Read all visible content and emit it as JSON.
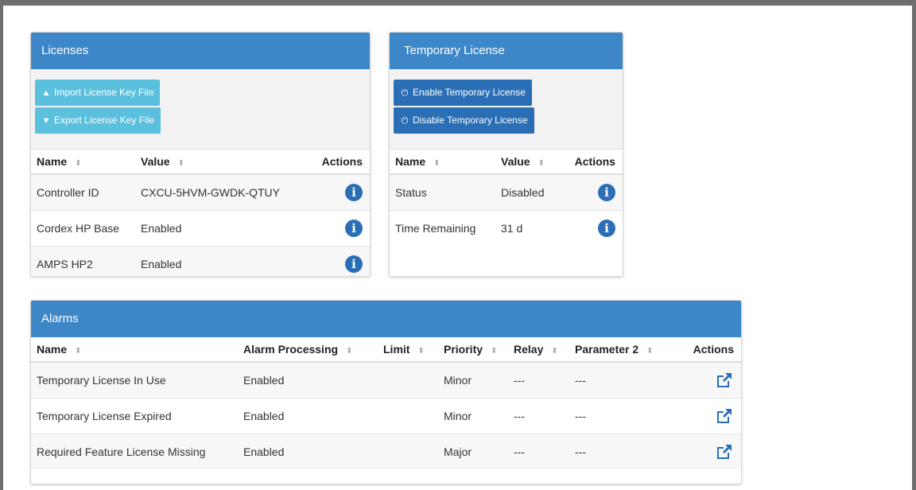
{
  "licenses": {
    "title": "Licenses",
    "import_label": "Import License Key File",
    "export_label": "Export License Key File",
    "columns": {
      "name": "Name",
      "value": "Value",
      "actions": "Actions"
    },
    "rows": [
      {
        "name": "Controller ID",
        "value": "CXCU-5HVM-GWDK-QTUY"
      },
      {
        "name": "Cordex HP Base",
        "value": "Enabled"
      },
      {
        "name": "AMPS HP2",
        "value": "Enabled"
      }
    ]
  },
  "temporary": {
    "title": "Temporary License",
    "enable_label": "Enable Temporary License",
    "disable_label": "Disable Temporary License",
    "columns": {
      "name": "Name",
      "value": "Value",
      "actions": "Actions"
    },
    "rows": [
      {
        "name": "Status",
        "value": "Disabled"
      },
      {
        "name": "Time Remaining",
        "value": "31 d"
      }
    ]
  },
  "alarms": {
    "title": "Alarms",
    "columns": {
      "name": "Name",
      "processing": "Alarm Processing",
      "limit": "Limit",
      "priority": "Priority",
      "relay": "Relay",
      "param2": "Parameter 2",
      "actions": "Actions"
    },
    "rows": [
      {
        "name": "Temporary License In Use",
        "processing": "Enabled",
        "limit": "",
        "priority": "Minor",
        "relay": "---",
        "param2": "---"
      },
      {
        "name": "Temporary License Expired",
        "processing": "Enabled",
        "limit": "",
        "priority": "Minor",
        "relay": "---",
        "param2": "---"
      },
      {
        "name": "Required Feature License Missing",
        "processing": "Enabled",
        "limit": "",
        "priority": "Major",
        "relay": "---",
        "param2": "---"
      }
    ]
  },
  "icons": {
    "info": "info-circle-icon",
    "edit": "external-edit-icon",
    "upload": "upload-icon",
    "download": "download-icon",
    "power": "power-icon",
    "sort": "sort-icon"
  },
  "colors": {
    "header": "#3d87c8",
    "primary": "#2a6fb5",
    "info_button": "#5bc0de"
  }
}
